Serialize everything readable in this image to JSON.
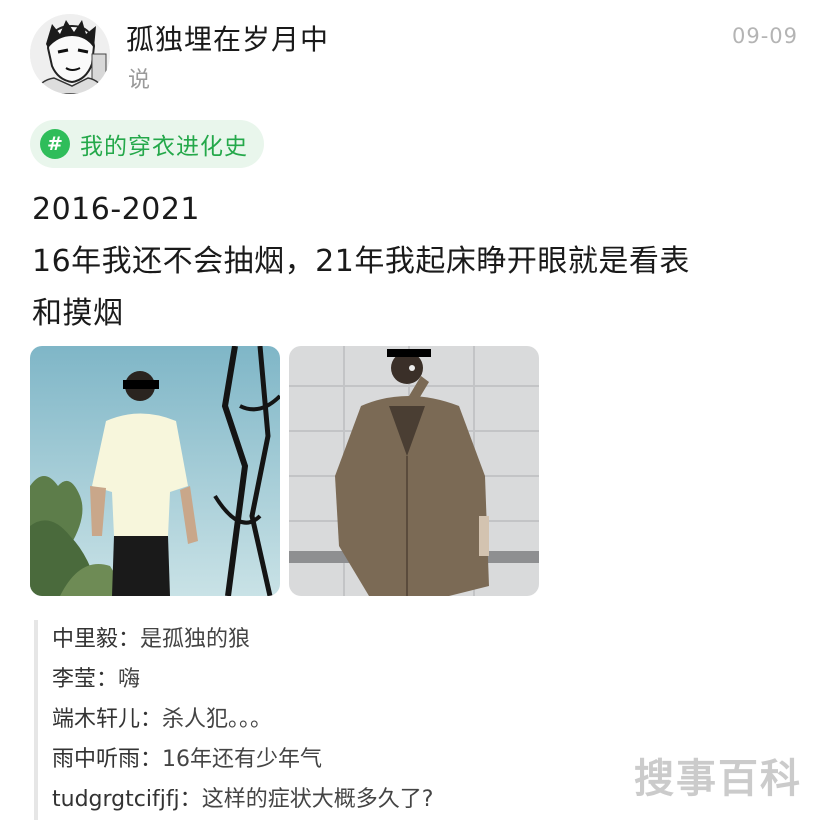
{
  "header": {
    "username": "孤独埋在岁月中",
    "subline": "说",
    "date": "09-09"
  },
  "topic": {
    "icon": "#",
    "label": "我的穿衣进化史"
  },
  "post": {
    "lines": [
      "2016-2021",
      "16年我还不会抽烟，21年我起床睁开眼就是看表",
      "和摸烟"
    ]
  },
  "photos": [
    {
      "name": "photo-2016",
      "description_icon": "person-white-tshirt-sky"
    },
    {
      "name": "photo-2021",
      "description_icon": "person-brown-jacket-smoking"
    }
  ],
  "comments": [
    {
      "name": "中里毅",
      "separator": "：",
      "text": "是孤独的狼"
    },
    {
      "name": "李莹",
      "separator": "：",
      "text": "嗨"
    },
    {
      "name": "端木轩儿",
      "separator": "：",
      "text": "杀人犯。。。"
    },
    {
      "name": "雨中听雨",
      "separator": "：",
      "text": "16年还有少年气"
    },
    {
      "name": "tudgrgtcifjfj",
      "separator": "：",
      "text": "这样的症状大概多久了?"
    }
  ],
  "watermark": "搜事百科",
  "colors": {
    "topic_bg": "#e9f6ec",
    "topic_accent": "#2fbd5a",
    "text_primary": "#1a1a1a",
    "text_muted": "#9a9a9a"
  }
}
